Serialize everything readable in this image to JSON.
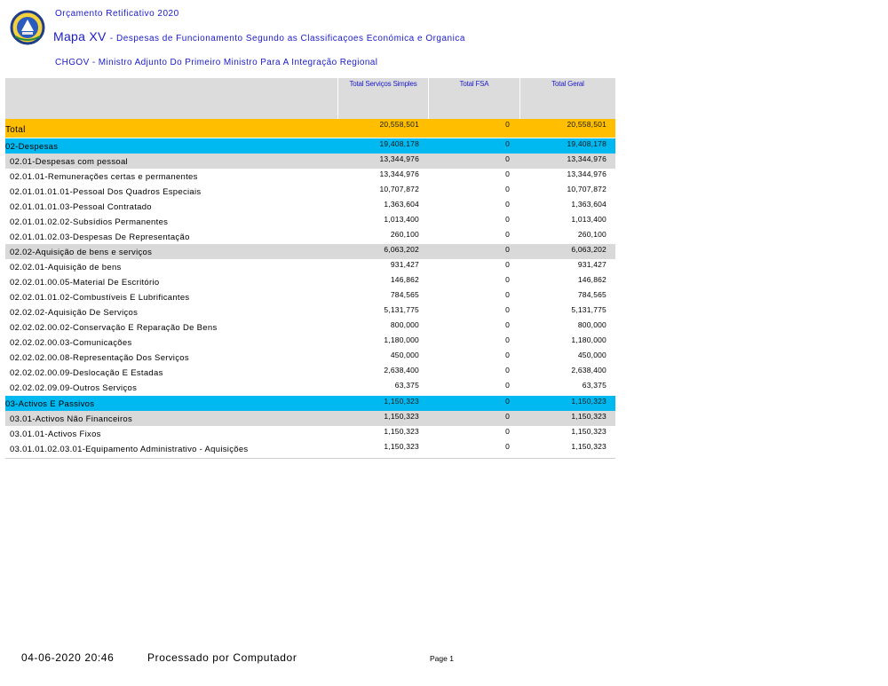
{
  "header": {
    "report_title": "Orçamento Retificativo 2020",
    "map_name": "Mapa XV",
    "map_separator": "-",
    "map_description": "Despesas de Funcionamento Segundo as Classificaçoes Económica e Organica",
    "entity": "CHGOV - Ministro Adjunto Do Primeiro Ministro Para A Integração Regional"
  },
  "columns": [
    "Total Serviços Simples",
    "Total FSA",
    "Total Geral"
  ],
  "colors": {
    "total": "#ffbf00",
    "level1": "#00b9f0",
    "level2": "#d9d9d9",
    "header_text": "#1a1acc"
  },
  "rows": [
    {
      "label": "Total",
      "simples": "20,558,501",
      "fsa": "0",
      "geral": "20,558,501",
      "level": "total"
    },
    {
      "label": "02-Despesas",
      "simples": "19,408,178",
      "fsa": "0",
      "geral": "19,408,178",
      "level": "l1"
    },
    {
      "label": "02.01-Despesas com pessoal",
      "simples": "13,344,976",
      "fsa": "0",
      "geral": "13,344,976",
      "level": "l2"
    },
    {
      "label": "02.01.01-Remunerações certas e permanentes",
      "simples": "13,344,976",
      "fsa": "0",
      "geral": "13,344,976",
      "level": "plain"
    },
    {
      "label": "02.01.01.01.01-Pessoal Dos Quadros Especiais",
      "simples": "10,707,872",
      "fsa": "0",
      "geral": "10,707,872",
      "level": "plain"
    },
    {
      "label": "02.01.01.01.03-Pessoal Contratado",
      "simples": "1,363,604",
      "fsa": "0",
      "geral": "1,363,604",
      "level": "plain"
    },
    {
      "label": "02.01.01.02.02-Subsídios Permanentes",
      "simples": "1,013,400",
      "fsa": "0",
      "geral": "1,013,400",
      "level": "plain"
    },
    {
      "label": "02.01.01.02.03-Despesas De Representação",
      "simples": "260,100",
      "fsa": "0",
      "geral": "260,100",
      "level": "plain"
    },
    {
      "label": "02.02-Aquisição de bens e serviços",
      "simples": "6,063,202",
      "fsa": "0",
      "geral": "6,063,202",
      "level": "l2"
    },
    {
      "label": "02.02.01-Aquisição de bens",
      "simples": "931,427",
      "fsa": "0",
      "geral": "931,427",
      "level": "plain"
    },
    {
      "label": "02.02.01.00.05-Material De Escritório",
      "simples": "146,862",
      "fsa": "0",
      "geral": "146,862",
      "level": "plain"
    },
    {
      "label": "02.02.01.01.02-Combustíveis E Lubrificantes",
      "simples": "784,565",
      "fsa": "0",
      "geral": "784,565",
      "level": "plain"
    },
    {
      "label": "02.02.02-Aquisição De Serviços",
      "simples": "5,131,775",
      "fsa": "0",
      "geral": "5,131,775",
      "level": "plain"
    },
    {
      "label": "02.02.02.00.02-Conservação E Reparação De Bens",
      "simples": "800,000",
      "fsa": "0",
      "geral": "800,000",
      "level": "plain"
    },
    {
      "label": "02.02.02.00.03-Comunicações",
      "simples": "1,180,000",
      "fsa": "0",
      "geral": "1,180,000",
      "level": "plain"
    },
    {
      "label": "02.02.02.00.08-Representação Dos Serviços",
      "simples": "450,000",
      "fsa": "0",
      "geral": "450,000",
      "level": "plain"
    },
    {
      "label": "02.02.02.00.09-Deslocação E Estadas",
      "simples": "2,638,400",
      "fsa": "0",
      "geral": "2,638,400",
      "level": "plain"
    },
    {
      "label": "02.02.02.09.09-Outros Serviços",
      "simples": "63,375",
      "fsa": "0",
      "geral": "63,375",
      "level": "plain"
    },
    {
      "label": "03-Activos E Passivos",
      "simples": "1,150,323",
      "fsa": "0",
      "geral": "1,150,323",
      "level": "l1"
    },
    {
      "label": "03.01-Activos Não Financeiros",
      "simples": "1,150,323",
      "fsa": "0",
      "geral": "1,150,323",
      "level": "l2"
    },
    {
      "label": "03.01.01-Activos Fixos",
      "simples": "1,150,323",
      "fsa": "0",
      "geral": "1,150,323",
      "level": "plain"
    },
    {
      "label": "03.01.01.02.03.01-Equipamento Administrativo - Aquisições",
      "simples": "1,150,323",
      "fsa": "0",
      "geral": "1,150,323",
      "level": "plain"
    }
  ],
  "footer": {
    "datetime": "04-06-2020 20:46",
    "processed_by": "Processado por Computador",
    "page_label": "Page 1"
  }
}
